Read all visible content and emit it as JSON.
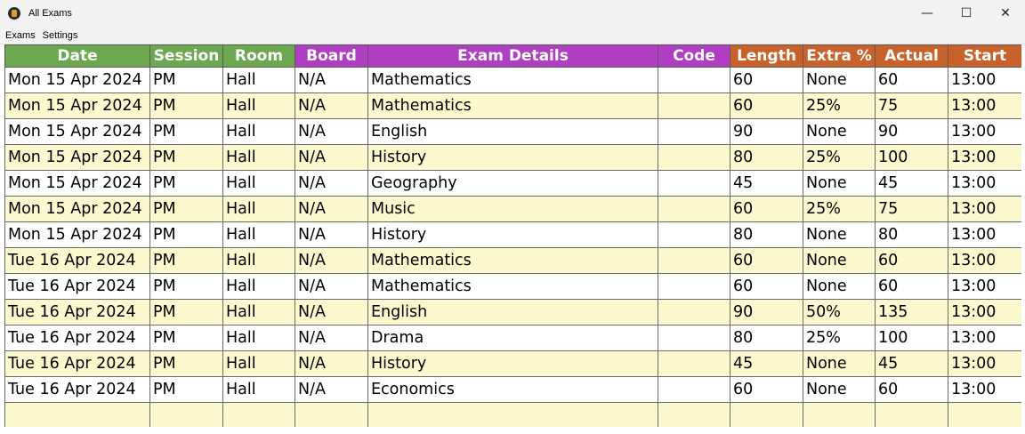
{
  "window": {
    "title": "All Exams",
    "controls": {
      "minimize": "—",
      "maximize": "☐",
      "close": "✕"
    }
  },
  "menu": [
    "Exams",
    "Settings"
  ],
  "colors": {
    "header_green": "#6ba84f",
    "header_purple": "#b03ec2",
    "header_orange": "#c8622a",
    "row_alt": "#fcf9cf"
  },
  "columns": [
    {
      "label": "Date",
      "group": "green"
    },
    {
      "label": "Session",
      "group": "green"
    },
    {
      "label": "Room",
      "group": "green"
    },
    {
      "label": "Board",
      "group": "purple"
    },
    {
      "label": "Exam Details",
      "group": "purple"
    },
    {
      "label": "Code",
      "group": "purple"
    },
    {
      "label": "Length",
      "group": "orange"
    },
    {
      "label": "Extra %",
      "group": "orange"
    },
    {
      "label": "Actual",
      "group": "orange"
    },
    {
      "label": "Start",
      "group": "orange"
    }
  ],
  "rows": [
    [
      "Mon 15 Apr 2024",
      "PM",
      "Hall",
      "N/A",
      "Mathematics",
      "",
      "60",
      "None",
      "60",
      "13:00"
    ],
    [
      "Mon 15 Apr 2024",
      "PM",
      "Hall",
      "N/A",
      "Mathematics",
      "",
      "60",
      "25%",
      "75",
      "13:00"
    ],
    [
      "Mon 15 Apr 2024",
      "PM",
      "Hall",
      "N/A",
      "English",
      "",
      "90",
      "None",
      "90",
      "13:00"
    ],
    [
      "Mon 15 Apr 2024",
      "PM",
      "Hall",
      "N/A",
      "History",
      "",
      "80",
      "25%",
      "100",
      "13:00"
    ],
    [
      "Mon 15 Apr 2024",
      "PM",
      "Hall",
      "N/A",
      "Geography",
      "",
      "45",
      "None",
      "45",
      "13:00"
    ],
    [
      "Mon 15 Apr 2024",
      "PM",
      "Hall",
      "N/A",
      "Music",
      "",
      "60",
      "25%",
      "75",
      "13:00"
    ],
    [
      "Mon 15 Apr 2024",
      "PM",
      "Hall",
      "N/A",
      "History",
      "",
      "80",
      "None",
      "80",
      "13:00"
    ],
    [
      "Tue 16 Apr 2024",
      "PM",
      "Hall",
      "N/A",
      "Mathematics",
      "",
      "60",
      "None",
      "60",
      "13:00"
    ],
    [
      "Tue 16 Apr 2024",
      "PM",
      "Hall",
      "N/A",
      "Mathematics",
      "",
      "60",
      "None",
      "60",
      "13:00"
    ],
    [
      "Tue 16 Apr 2024",
      "PM",
      "Hall",
      "N/A",
      "English",
      "",
      "90",
      "50%",
      "135",
      "13:00"
    ],
    [
      "Tue 16 Apr 2024",
      "PM",
      "Hall",
      "N/A",
      "Drama",
      "",
      "80",
      "25%",
      "100",
      "13:00"
    ],
    [
      "Tue 16 Apr 2024",
      "PM",
      "Hall",
      "N/A",
      "History",
      "",
      "45",
      "None",
      "45",
      "13:00"
    ],
    [
      "Tue 16 Apr 2024",
      "PM",
      "Hall",
      "N/A",
      "Economics",
      "",
      "60",
      "None",
      "60",
      "13:00"
    ],
    [
      "",
      "",
      "",
      "",
      "",
      "",
      "",
      "",
      "",
      ""
    ]
  ]
}
